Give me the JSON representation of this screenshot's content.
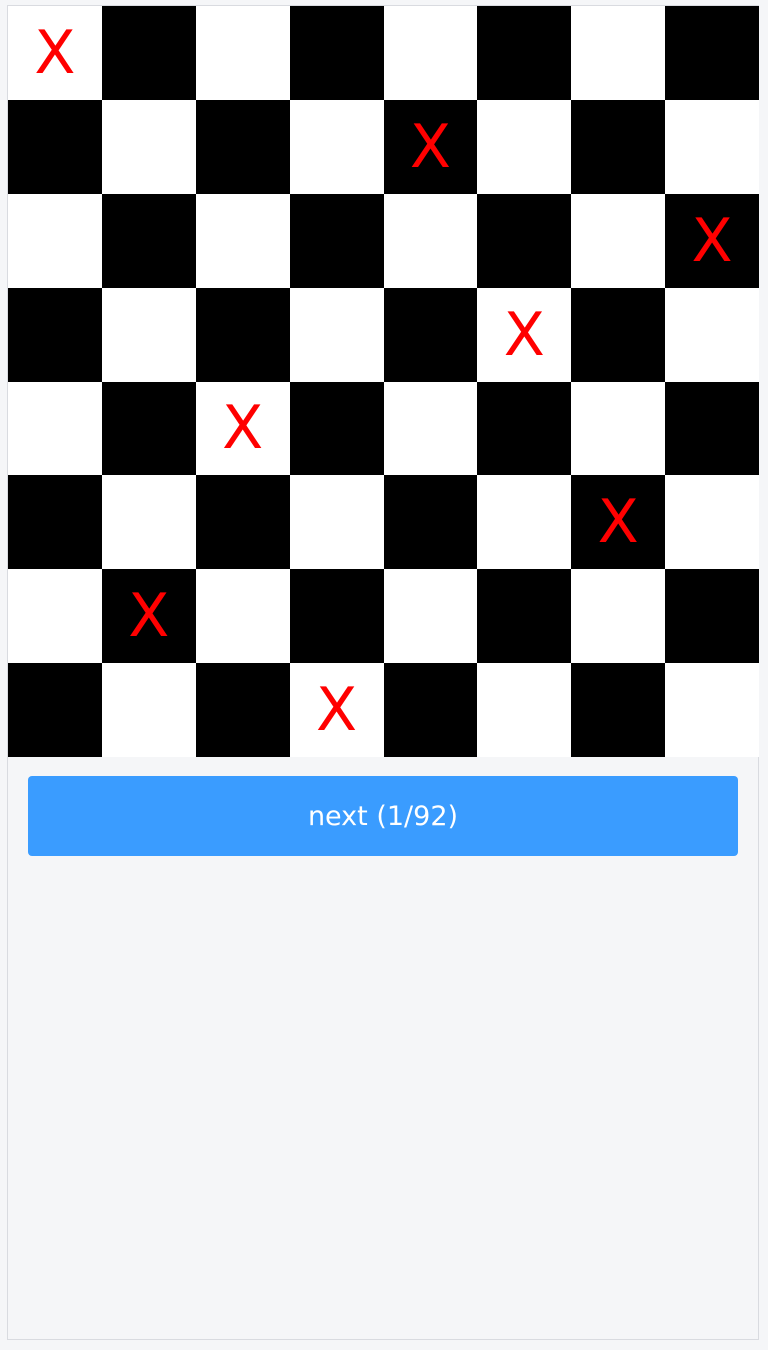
{
  "board": {
    "size": 8,
    "light_color": "#ffffff",
    "dark_color": "#000000",
    "queen_symbol": "X",
    "queen_color": "#ff0000",
    "queen_columns_by_row": [
      0,
      4,
      7,
      5,
      2,
      6,
      1,
      3
    ]
  },
  "controls": {
    "next_label": "next (1/92)",
    "next_color": "#3a9cff"
  }
}
